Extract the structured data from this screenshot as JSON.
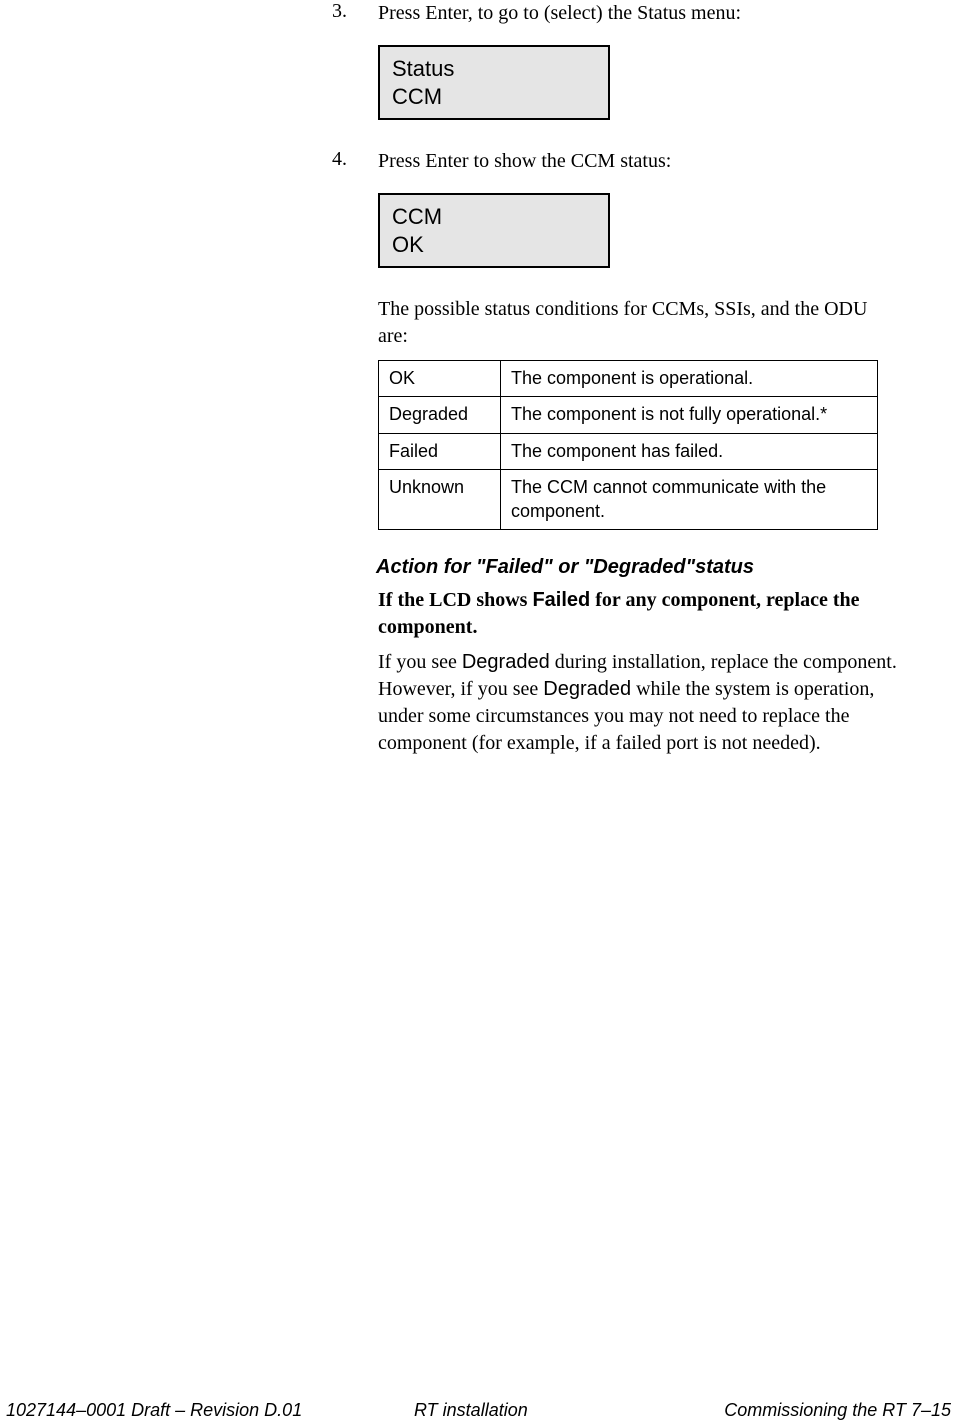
{
  "steps": {
    "step3": {
      "num": "3.",
      "text": "Press Enter, to go to (select) the Status menu:"
    },
    "step4": {
      "num": "4.",
      "text": "Press Enter to show the CCM status:"
    }
  },
  "lcd1": {
    "line1": "Status",
    "line2": "CCM"
  },
  "lcd2": {
    "line1": "CCM",
    "line2": "OK"
  },
  "intro_table": "The possible status conditions for CCMs, SSIs, and the ODU are:",
  "table": {
    "rows": [
      {
        "status": "OK",
        "desc": "The component is operational."
      },
      {
        "status": "Degraded",
        "desc": "The component is not fully operational.*"
      },
      {
        "status": "Failed",
        "desc": "The component has failed."
      },
      {
        "status": "Unknown",
        "desc": "The CCM cannot communicate with the component."
      }
    ]
  },
  "heading_action": "Action for \"Failed\" or \"Degraded\"status",
  "bold_para": {
    "p1": "If the LCD shows ",
    "failed": "Failed",
    "p2": " for any component, replace the component."
  },
  "para": {
    "p1": "If you see ",
    "d1": "Degraded",
    "p2": " during installation, replace the component. However, if you see ",
    "d2": "Degraded",
    "p3": " while the system is operation, under some circumstances you may not need to replace the component (for example, if a failed port is not needed)."
  },
  "footer": {
    "left": "1027144–0001  Draft – Revision D.01",
    "center": "RT installation",
    "right": "Commissioning the RT   7–15"
  }
}
